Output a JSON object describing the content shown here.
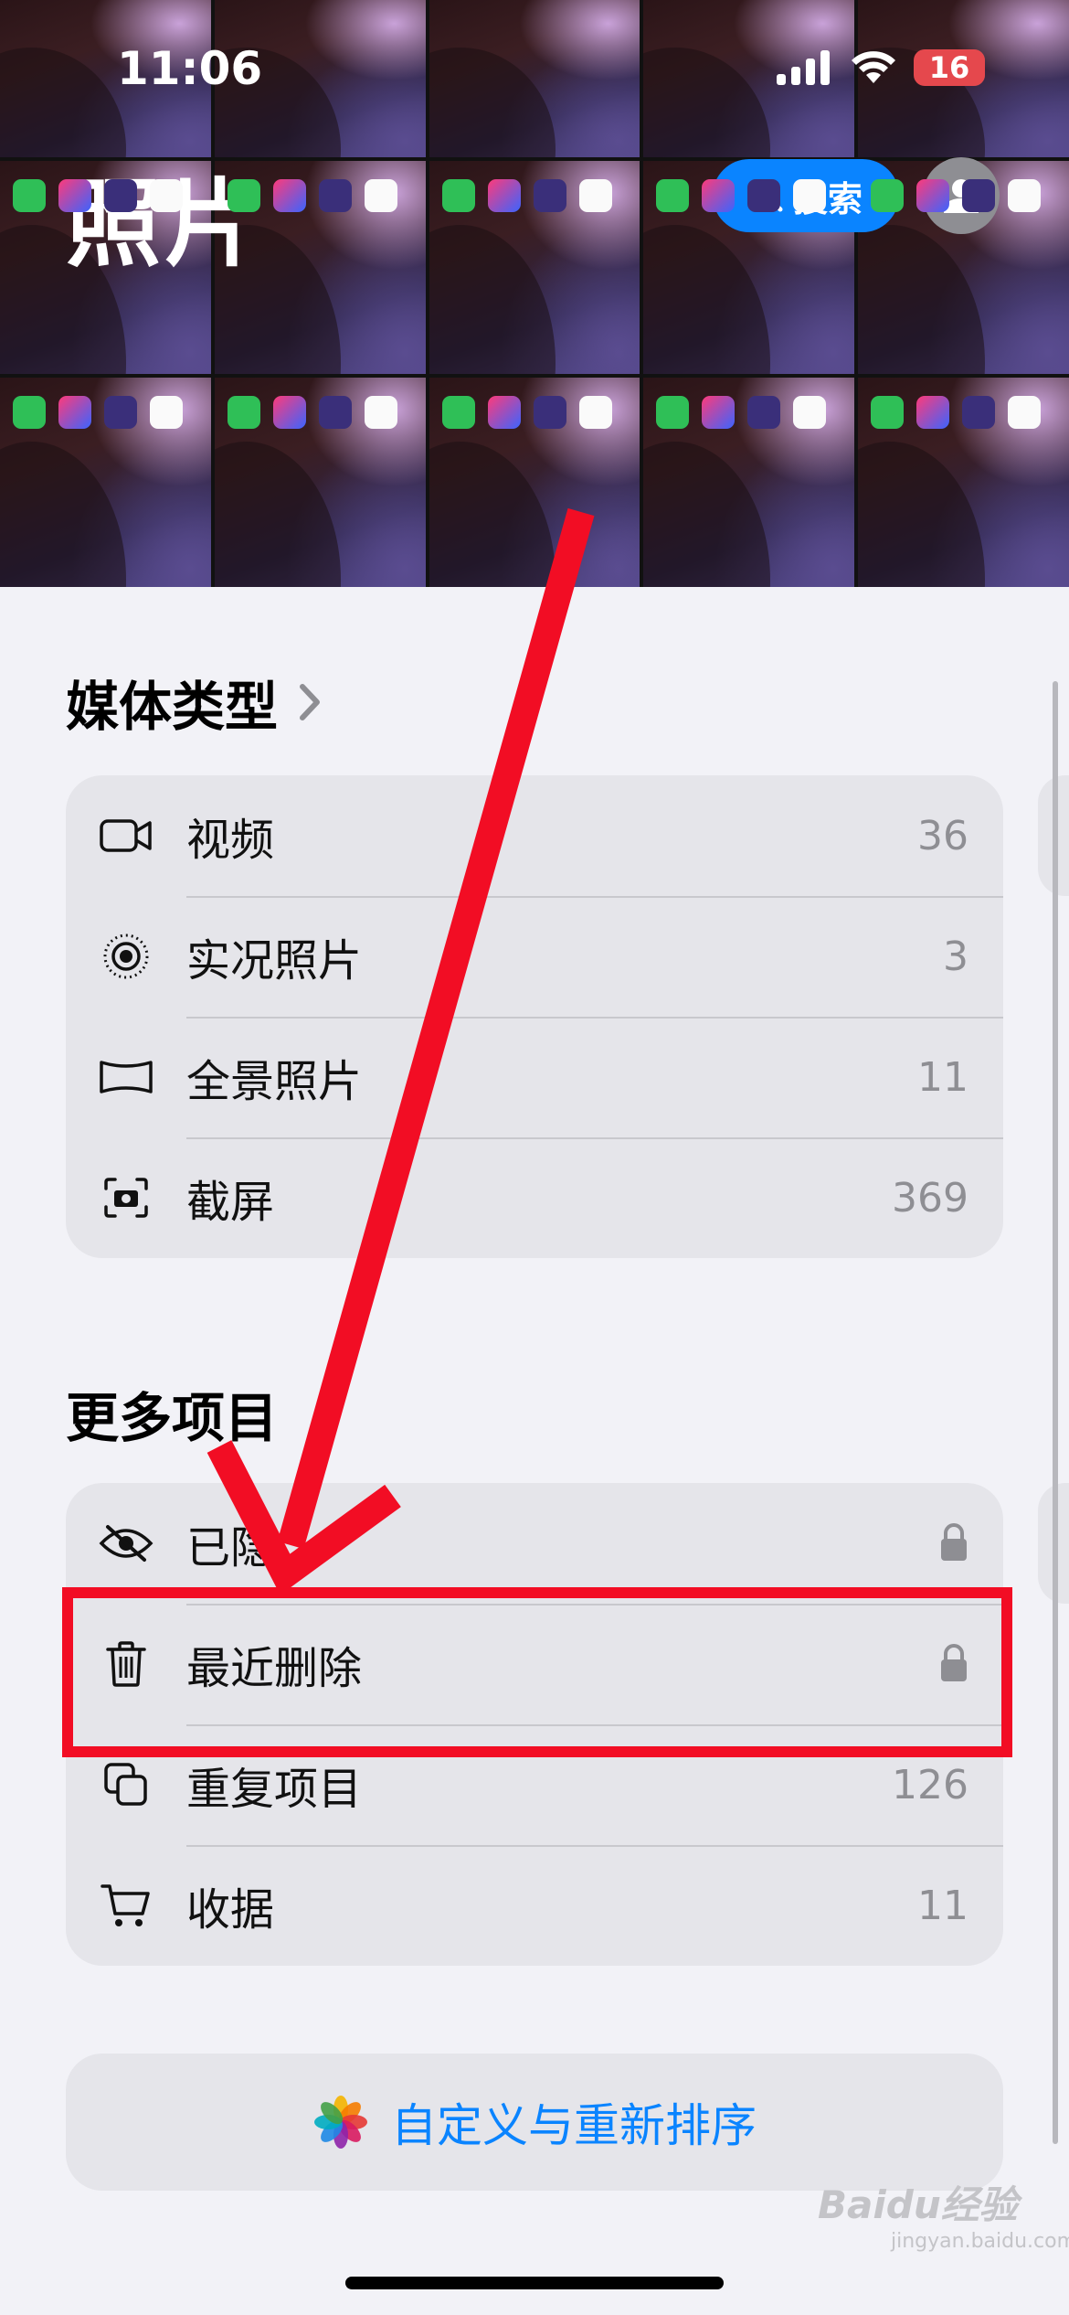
{
  "status_bar": {
    "time": "11:06",
    "battery": "16"
  },
  "header": {
    "title": "照片",
    "search_label": "搜索"
  },
  "media_types": {
    "heading": "媒体类型",
    "items": [
      {
        "icon": "video-icon",
        "label": "视频",
        "count": "36"
      },
      {
        "icon": "live-photo-icon",
        "label": "实况照片",
        "count": "3"
      },
      {
        "icon": "panorama-icon",
        "label": "全景照片",
        "count": "11"
      },
      {
        "icon": "screenshot-icon",
        "label": "截屏",
        "count": "369"
      }
    ]
  },
  "more_items": {
    "heading": "更多项目",
    "items": [
      {
        "icon": "eye-slash-icon",
        "label": "已隐",
        "locked": true
      },
      {
        "icon": "trash-icon",
        "label": "最近删除",
        "locked": true
      },
      {
        "icon": "duplicate-icon",
        "label": "重复项目",
        "count": "126"
      },
      {
        "icon": "cart-icon",
        "label": "收据",
        "count": "11"
      }
    ]
  },
  "customize_label": "自定义与重新排序",
  "watermark": {
    "brand": "Baidu经验",
    "url": "jingyan.baidu.com"
  },
  "colors": {
    "accent": "#0a84ff",
    "annotation": "#f20d24",
    "card": "#e5e5ea",
    "background": "#f2f2f7"
  }
}
